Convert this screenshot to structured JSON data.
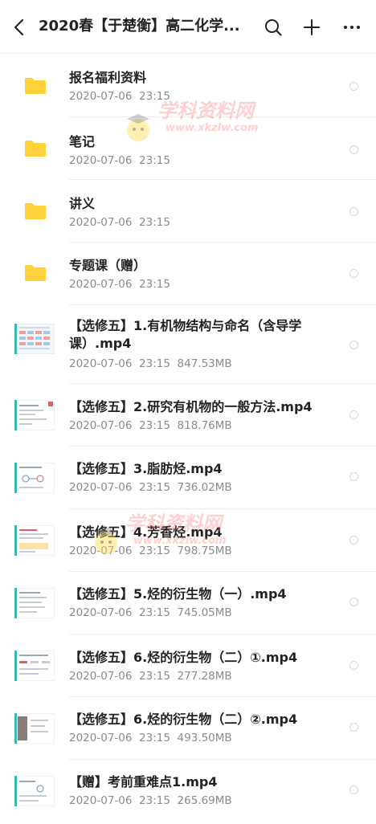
{
  "header": {
    "title": "2020春【于楚衡】高二化学...",
    "back_icon": "chevron-left-icon",
    "search_icon": "search-icon",
    "add_icon": "plus-icon",
    "more_icon": "more-horizontal-icon"
  },
  "colors": {
    "folder": "#FFD13B",
    "meta_text": "#8a8a8a",
    "separator": "#ececec"
  },
  "items": [
    {
      "type": "folder",
      "name": "报名福利资料",
      "meta": "2020-07-06  23:15"
    },
    {
      "type": "folder",
      "name": "笔记",
      "meta": "2020-07-06  23:15"
    },
    {
      "type": "folder",
      "name": "讲义",
      "meta": "2020-07-06  23:15"
    },
    {
      "type": "folder",
      "name": "专题课（赠）",
      "meta": "2020-07-06  23:15"
    },
    {
      "type": "video",
      "name": "【选修五】1.有机物结构与命名（含导学课）.mp4",
      "meta": "2020-07-06  23:15  847.53MB"
    },
    {
      "type": "video",
      "name": "【选修五】2.研究有机物的一般方法.mp4",
      "meta": "2020-07-06  23:15  818.76MB"
    },
    {
      "type": "video",
      "name": "【选修五】3.脂肪烃.mp4",
      "meta": "2020-07-06  23:15  736.02MB"
    },
    {
      "type": "video",
      "name": "【选修五】4.芳香烃.mp4",
      "meta": "2020-07-06  23:15  798.75MB"
    },
    {
      "type": "video",
      "name": "【选修五】5.烃的衍生物（一）.mp4",
      "meta": "2020-07-06  23:15  745.05MB"
    },
    {
      "type": "video",
      "name": "【选修五】6.烃的衍生物（二）①.mp4",
      "meta": "2020-07-06  23:15  277.28MB"
    },
    {
      "type": "video",
      "name": "【选修五】6.烃的衍生物（二）②.mp4",
      "meta": "2020-07-06  23:15  493.50MB"
    },
    {
      "type": "video",
      "name": "【赠】考前重难点1.mp4",
      "meta": "2020-07-06  23:15  265.69MB"
    }
  ],
  "watermark": {
    "big": "学科资料网",
    "small": "www.xkzlw.com"
  }
}
